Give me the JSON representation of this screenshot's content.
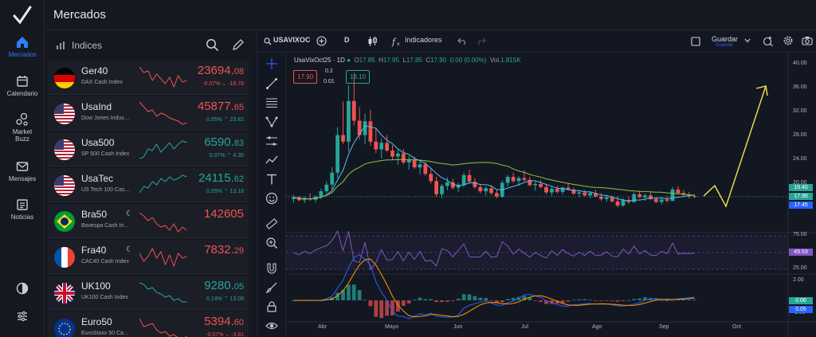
{
  "app": {
    "title": "Mercados"
  },
  "rail": {
    "items": [
      {
        "label": "Mercados",
        "icon": "home-icon",
        "active": true
      },
      {
        "label": "Calendario",
        "icon": "calendar-icon"
      },
      {
        "label": "Market Buzz",
        "icon": "bubbles-icon"
      },
      {
        "label": "Mensajes",
        "icon": "mail-icon"
      },
      {
        "label": "Noticias",
        "icon": "news-icon"
      }
    ],
    "bottom": [
      "theme-icon",
      "settings-sliders-icon"
    ]
  },
  "watchlist": {
    "title": "Indices",
    "rows": [
      {
        "symbol": "Ger40",
        "desc": "DAX Cash Index",
        "price_int": "23694.",
        "price_dec": "08",
        "change": "-0.07% ⌄ -16.78",
        "dir": "dn",
        "flag": "de",
        "night": false
      },
      {
        "symbol": "UsaInd",
        "desc": "Dow Jones Indus…",
        "price_int": "45877.",
        "price_dec": "65",
        "change": "0.05% ⌃ 23.82",
        "dir": "dn",
        "flag": "us",
        "night": false
      },
      {
        "symbol": "Usa500",
        "desc": "SP 500 Cash Index",
        "price_int": "6590.",
        "price_dec": "83",
        "change": "0.07% ⌃ 4.30",
        "dir": "up",
        "flag": "us",
        "night": false
      },
      {
        "symbol": "UsaTec",
        "desc": "US Tech 100 Cas…",
        "price_int": "24115.",
        "price_dec": "62",
        "change": "0.05% ⌃ 13.18",
        "dir": "up",
        "flag": "us",
        "night": false
      },
      {
        "symbol": "Bra50",
        "desc": "Bovespa Cash In…",
        "price_int": "142605",
        "price_dec": "",
        "change": "",
        "dir": "dn",
        "flag": "br",
        "night": true
      },
      {
        "symbol": "Fra40",
        "desc": "CAC40 Cash Index",
        "price_int": "7832.",
        "price_dec": "29",
        "change": "",
        "dir": "dn",
        "flag": "fr",
        "night": true
      },
      {
        "symbol": "UK100",
        "desc": "UK100 Cash Index",
        "price_int": "9280.",
        "price_dec": "05",
        "change": "0.14% ⌃ 13.08",
        "dir": "up",
        "flag": "uk",
        "night": false
      },
      {
        "symbol": "Euro50",
        "desc": "EuroStoxx 50 Ca…",
        "price_int": "5394.",
        "price_dec": "60",
        "change": "-0.07% ⌄ -3.81",
        "dir": "dn",
        "flag": "eu",
        "night": false
      }
    ]
  },
  "chart_toolbar": {
    "symbol": "USAVIXOC",
    "interval": "D",
    "indicators": "Indicadores",
    "save": "Guardar",
    "save_sub": "Guardar"
  },
  "chart_data": {
    "type": "candlestick",
    "legend": {
      "name": "UsaVixOct25 · 1D",
      "open": "17.85",
      "high": "17.95",
      "low": "17.85",
      "close": "17.90",
      "change": "0.00 (0.00%)",
      "vol": "1.815K"
    },
    "bid_box": "17.90",
    "ask_box": "18.10",
    "spread": {
      "top": "0.2",
      "bottom": "0.01"
    },
    "price_axis": [
      "40.00",
      "36.00",
      "32.00",
      "28.00",
      "24.00",
      "20.00",
      "16.00"
    ],
    "price_tags": [
      {
        "value": "19.40",
        "color": "#26a69a"
      },
      {
        "value": "17.90",
        "color": "#26a69a"
      },
      {
        "value": "17.45",
        "color": "#2962ff"
      }
    ],
    "rsi_axis": [
      "75.00",
      "25.00"
    ],
    "rsi_tag": "49.53",
    "macd_axis": [
      "2.00",
      "-2.00"
    ],
    "macd_tags": [
      {
        "value": "0.06",
        "color": "#26a69a"
      },
      {
        "value": "0.05",
        "color": "#2962ff"
      }
    ],
    "x_labels": [
      "Abr",
      "Mayo",
      "Jun",
      "Jul",
      "Ago",
      "Sep",
      "Oct"
    ],
    "candles": [
      [
        17.5,
        18.2,
        16.9,
        17.8
      ],
      [
        17.8,
        18.0,
        17.1,
        17.3
      ],
      [
        17.3,
        17.9,
        16.8,
        17.6
      ],
      [
        17.6,
        18.4,
        17.2,
        17.4
      ],
      [
        17.4,
        18.1,
        16.9,
        17.9
      ],
      [
        17.9,
        19.2,
        17.5,
        18.8
      ],
      [
        18.8,
        20.5,
        18.3,
        19.9
      ],
      [
        19.9,
        22.8,
        19.1,
        21.9
      ],
      [
        21.9,
        29.5,
        21.0,
        28.2
      ],
      [
        28.2,
        33.8,
        26.7,
        27.1
      ],
      [
        27.1,
        36.5,
        25.4,
        33.9
      ],
      [
        33.9,
        38.6,
        29.8,
        30.6
      ],
      [
        30.6,
        32.9,
        27.5,
        28.2
      ],
      [
        28.2,
        31.8,
        26.7,
        30.5
      ],
      [
        30.5,
        32.4,
        26.4,
        27.1
      ],
      [
        27.1,
        29.4,
        25.2,
        25.8
      ],
      [
        25.8,
        27.6,
        24.3,
        26.9
      ],
      [
        26.9,
        28.2,
        25.4,
        25.6
      ],
      [
        25.6,
        26.5,
        24.1,
        24.6
      ],
      [
        24.6,
        25.7,
        23.2,
        25.1
      ],
      [
        25.1,
        25.9,
        23.3,
        23.6
      ],
      [
        23.6,
        24.7,
        22.4,
        24.0
      ],
      [
        24.0,
        24.6,
        22.5,
        22.8
      ],
      [
        22.8,
        23.9,
        21.6,
        23.3
      ],
      [
        23.3,
        23.8,
        21.4,
        21.7
      ],
      [
        21.7,
        22.6,
        20.1,
        20.5
      ],
      [
        20.5,
        21.2,
        17.9,
        18.3
      ],
      [
        18.3,
        20.0,
        17.6,
        19.7
      ],
      [
        19.7,
        21.1,
        19.0,
        20.3
      ],
      [
        20.3,
        20.9,
        19.1,
        19.4
      ],
      [
        19.4,
        20.2,
        18.7,
        19.9
      ],
      [
        19.9,
        21.9,
        19.5,
        21.5
      ],
      [
        21.5,
        22.4,
        20.1,
        20.4
      ],
      [
        20.4,
        21.0,
        19.2,
        19.5
      ],
      [
        19.5,
        20.0,
        18.4,
        18.8
      ],
      [
        18.8,
        19.6,
        18.1,
        19.3
      ],
      [
        19.3,
        19.8,
        18.2,
        18.5
      ],
      [
        18.5,
        19.0,
        17.6,
        17.9
      ],
      [
        17.9,
        20.6,
        17.7,
        20.2
      ],
      [
        20.2,
        21.5,
        19.6,
        21.2
      ],
      [
        21.2,
        21.9,
        20.2,
        20.5
      ],
      [
        20.5,
        21.3,
        19.7,
        21.0
      ],
      [
        21.0,
        22.3,
        20.4,
        20.7
      ],
      [
        20.7,
        21.2,
        19.6,
        19.8
      ],
      [
        19.8,
        20.4,
        18.9,
        20.0
      ],
      [
        20.0,
        20.7,
        19.3,
        19.5
      ],
      [
        19.5,
        19.9,
        18.3,
        18.6
      ],
      [
        18.6,
        19.5,
        18.0,
        19.2
      ],
      [
        19.2,
        19.7,
        18.4,
        18.7
      ],
      [
        18.7,
        19.6,
        18.3,
        19.4
      ],
      [
        19.4,
        20.1,
        18.9,
        19.1
      ],
      [
        19.1,
        19.4,
        18.2,
        18.4
      ],
      [
        18.4,
        18.9,
        17.8,
        18.6
      ],
      [
        18.6,
        19.0,
        17.9,
        18.1
      ],
      [
        18.1,
        18.8,
        17.6,
        18.5
      ],
      [
        18.5,
        19.0,
        17.8,
        17.9
      ],
      [
        17.9,
        18.5,
        17.2,
        17.5
      ],
      [
        17.5,
        18.2,
        17.0,
        17.8
      ],
      [
        17.8,
        18.1,
        16.9,
        17.1
      ],
      [
        17.1,
        17.9,
        16.1,
        16.4
      ],
      [
        16.4,
        17.6,
        16.2,
        17.3
      ],
      [
        17.3,
        17.8,
        16.7,
        17.0
      ],
      [
        17.0,
        18.6,
        16.9,
        18.3
      ],
      [
        18.3,
        18.9,
        17.6,
        17.8
      ],
      [
        17.8,
        18.4,
        17.2,
        18.1
      ],
      [
        18.1,
        18.6,
        17.3,
        17.5
      ],
      [
        17.5,
        17.9,
        16.8,
        17.0
      ],
      [
        17.0,
        17.6,
        16.6,
        17.4
      ],
      [
        17.4,
        18.0,
        16.9,
        17.2
      ],
      [
        17.2,
        19.5,
        17.1,
        19.1
      ],
      [
        19.1,
        19.6,
        18.3,
        18.5
      ],
      [
        18.5,
        19.0,
        17.9,
        18.2
      ],
      [
        18.2,
        18.7,
        17.6,
        18.0
      ],
      [
        18.0,
        18.3,
        17.6,
        17.9
      ]
    ]
  }
}
